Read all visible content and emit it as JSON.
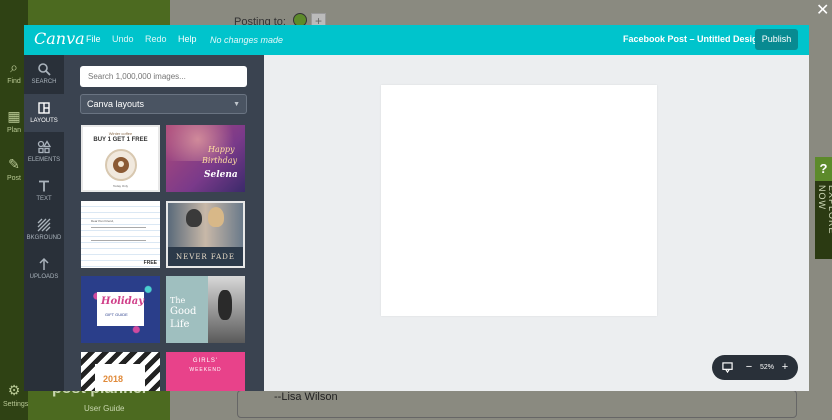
{
  "background": {
    "posting_label": "Posting to:",
    "quote_text": "--Lisa Wilson",
    "brand": "post planner",
    "user_guide": "User Guide",
    "explore_label": "EXPLORE NOW",
    "nav": [
      {
        "label": "Find",
        "icon": "magnifier-icon"
      },
      {
        "label": "Plan",
        "icon": "grid-icon"
      },
      {
        "label": "Post",
        "icon": "pencil-icon"
      },
      {
        "label": "Settings",
        "icon": "gear-icon"
      }
    ]
  },
  "topbar": {
    "menu": [
      "File",
      "Undo",
      "Redo",
      "Help"
    ],
    "status": "No changes made",
    "doc_title": "Facebook Post – Untitled Design",
    "publish": "Publish"
  },
  "sidenav": [
    {
      "label": "SEARCH",
      "icon": "search-icon"
    },
    {
      "label": "LAYOUTS",
      "icon": "layouts-icon"
    },
    {
      "label": "ELEMENTS",
      "icon": "elements-icon"
    },
    {
      "label": "TEXT",
      "icon": "text-icon"
    },
    {
      "label": "BKGROUND",
      "icon": "background-icon"
    },
    {
      "label": "UPLOADS",
      "icon": "upload-icon"
    }
  ],
  "panel": {
    "search_placeholder": "Search 1,000,000 images...",
    "category": "Canva layouts",
    "layouts": [
      {
        "lines": [
          "Winter coffee",
          "BUY 1 GET 1 FREE",
          "Today Only"
        ]
      },
      {
        "lines": [
          "Happy",
          "Birthday",
          "Selena"
        ]
      },
      {
        "lines": [
          "Dear Pen Friend,"
        ],
        "badge": "FREE"
      },
      {
        "lines": [
          "NEVER FADE"
        ]
      },
      {
        "lines": [
          "Holiday",
          "GIFT GUIDE"
        ]
      },
      {
        "lines": [
          "The",
          "Good",
          "Life"
        ]
      },
      {
        "lines": [
          "2018"
        ]
      },
      {
        "lines": [
          "GIRLS'",
          "WEEKEND"
        ]
      }
    ]
  },
  "zoom": {
    "level": "52%",
    "minus": "−",
    "plus": "+"
  }
}
